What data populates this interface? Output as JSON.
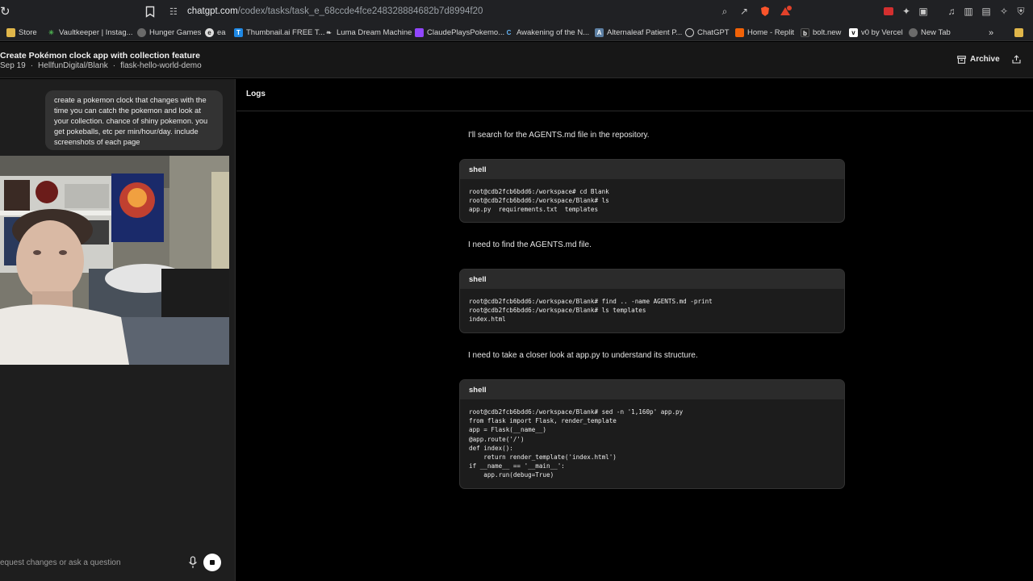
{
  "browser": {
    "url_host": "chatgpt.com",
    "url_path": "/codex/tasks/task_e_68ccde4fce248328884682b7d8994f20",
    "bookmarks": [
      {
        "label": "Store",
        "icon": "folder-icon",
        "color": "#e0b64a"
      },
      {
        "label": "Vaultkeeper | Instag...",
        "icon": "star-burst-icon",
        "color": "#4caf50"
      },
      {
        "label": "Hunger Games",
        "icon": "globe-icon",
        "color": "#9e9e9e"
      },
      {
        "label": "ea",
        "icon": "ea-icon",
        "color": "#dddddd"
      },
      {
        "label": "Thumbnail.ai FREE T...",
        "icon": "thumbnail-icon",
        "color": "#1e88e5"
      },
      {
        "label": "Luma Dream Machine",
        "icon": "luma-icon",
        "color": "#cccccc"
      },
      {
        "label": "ClaudePlaysPokemo...",
        "icon": "twitch-icon",
        "color": "#9146ff"
      },
      {
        "label": "Awakening of the N...",
        "icon": "c-icon",
        "color": "#1565c0"
      },
      {
        "label": "Alternaleaf Patient P...",
        "icon": "leaf-icon",
        "color": "#5c7fa3"
      },
      {
        "label": "ChatGPT",
        "icon": "openai-icon",
        "color": "#cccccc"
      },
      {
        "label": "Home - Replit",
        "icon": "replit-icon",
        "color": "#f26207"
      },
      {
        "label": "bolt.new",
        "icon": "bolt-icon",
        "color": "#222222"
      },
      {
        "label": "v0 by Vercel",
        "icon": "v0-icon",
        "color": "#ffffff"
      },
      {
        "label": "New Tab",
        "icon": "globe-icon",
        "color": "#9e9e9e"
      }
    ]
  },
  "header": {
    "title": "Create Pokémon clock app with collection feature",
    "date": "Sep 19",
    "repo": "HellfunDigital/Blank",
    "branch": "flask-hello-world-demo",
    "archive_label": "Archive"
  },
  "left": {
    "prompt": "create a pokemon clock that changes with the time you can catch the pokemon and look at your collection. chance of shiny pokemon. you get pokeballs, etc per min/hour/day. include screenshots of each page",
    "composer_placeholder": "equest changes or ask a question"
  },
  "logs": {
    "tab_label": "Logs",
    "messages": [
      "I'll search for the AGENTS.md file in the repository.",
      "I need to find the AGENTS.md file.",
      "I need to take a closer look at app.py to understand its structure."
    ],
    "shells": [
      {
        "title": "shell",
        "lines": [
          "root@cdb2fcb6bdd6:/workspace# cd Blank",
          "root@cdb2fcb6bdd6:/workspace/Blank# ls",
          "app.py  requirements.txt  templates"
        ]
      },
      {
        "title": "shell",
        "lines": [
          "root@cdb2fcb6bdd6:/workspace/Blank# find .. -name AGENTS.md -print",
          "root@cdb2fcb6bdd6:/workspace/Blank# ls templates",
          "index.html"
        ]
      },
      {
        "title": "shell",
        "lines": [
          "root@cdb2fcb6bdd6:/workspace/Blank# sed -n '1,160p' app.py",
          "from flask import Flask, render_template",
          "app = Flask(__name__)",
          "@app.route('/')",
          "def index():",
          "    return render_template('index.html')",
          "if __name__ == '__main__':",
          "    app.run(debug=True)"
        ]
      }
    ]
  }
}
